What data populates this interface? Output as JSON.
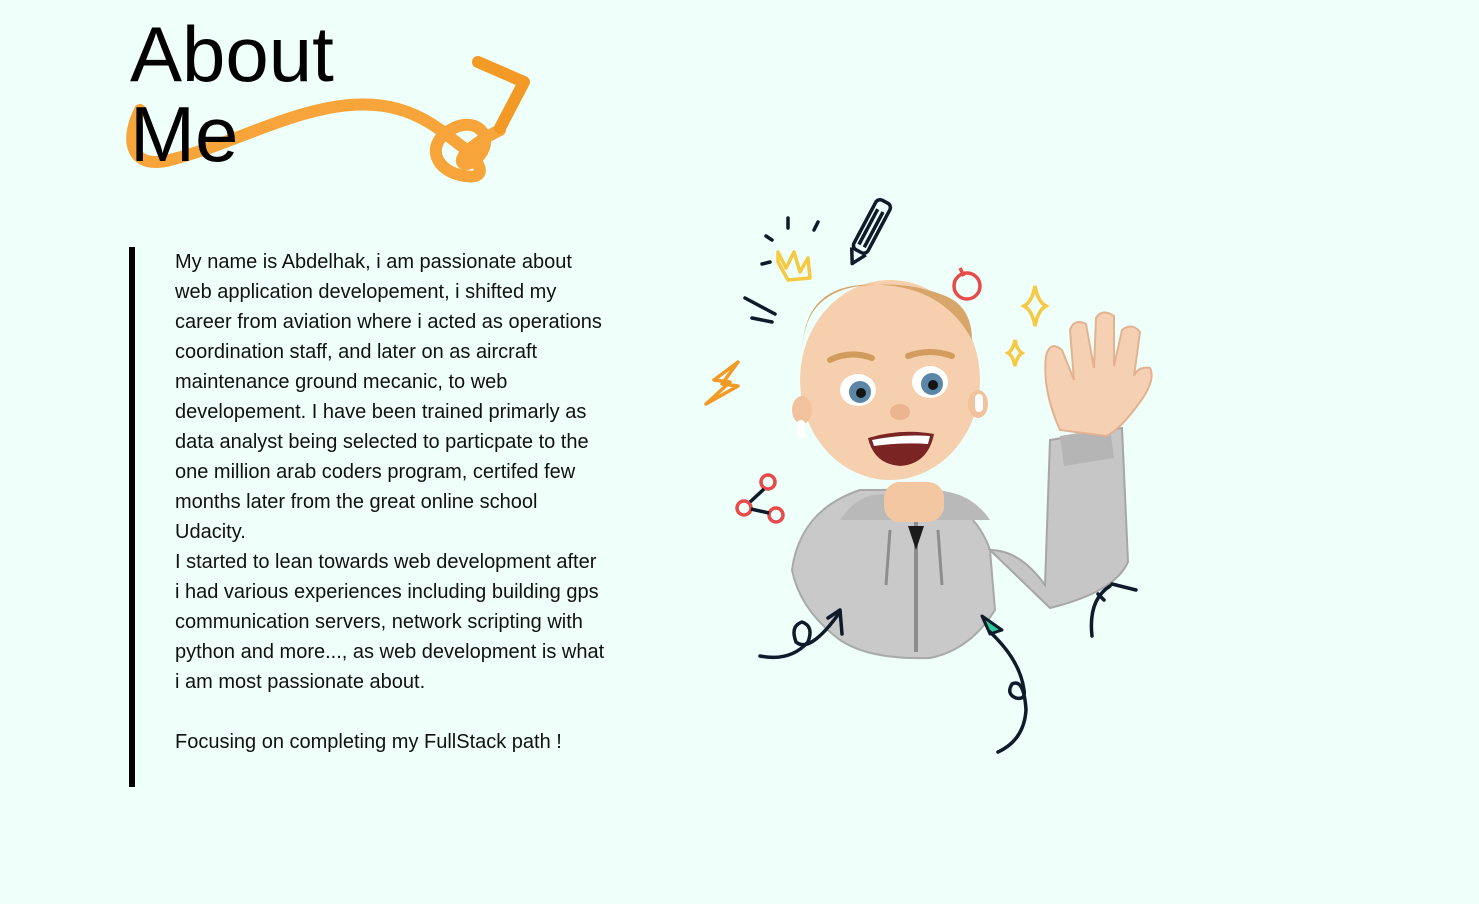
{
  "title": {
    "line1": "About",
    "line2": "Me"
  },
  "bio": {
    "paragraph1": "My name is Abdelhak, i am passionate about web application developement, i shifted my career from aviation where i acted as operations coordination staff, and later on as aircraft maintenance ground mecanic, to web developement. I have been trained primarly as data analyst being selected to particpate to the one million arab coders program, certifed few months later from the great online school Udacity.",
    "paragraph2": "I started to lean towards web development after i had various experiences including building gps communication servers, network scripting with python and more..., as web development is what i am most passionate about.",
    "paragraph3": "Focusing on completing my FullStack path !"
  },
  "illustration": {
    "subject": "waving-memoji-avatar",
    "icons": [
      "crown-icon",
      "pencil-icon",
      "pin-icon",
      "sparkle-icon",
      "lightning-icon",
      "share-icon",
      "arrow-icon",
      "cursor-icon"
    ]
  },
  "colors": {
    "background": "#effffa",
    "accent_swoosh": "#f7a030",
    "text": "#000000"
  }
}
